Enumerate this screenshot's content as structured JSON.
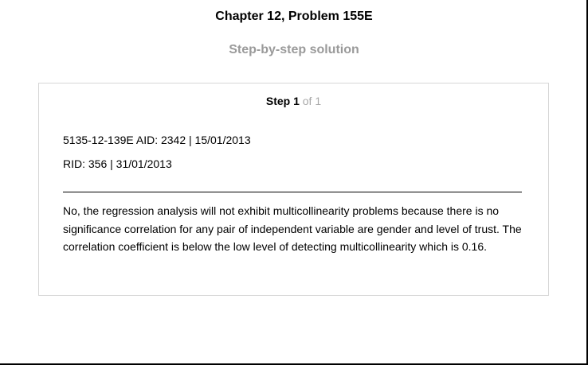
{
  "header": {
    "chapter_title": "Chapter 12, Problem 155E",
    "subtitle": "Step-by-step solution"
  },
  "step": {
    "label": "Step 1",
    "of_text": "of 1",
    "meta_line_1": "5135-12-139E AID: 2342 | 15/01/2013",
    "meta_line_2": "RID: 356 | 31/01/2013",
    "answer": "No, the regression analysis will not exhibit multicollinearity problems because there is no significance correlation for any pair of independent variable are gender and level of trust. The correlation coefficient is below the low level of detecting multicollinearity which is 0.16."
  },
  "colors": {
    "subtitle_gray": "#9a9a9a",
    "step_of_gray": "#a8a8a8",
    "card_border": "#d6d6d6"
  }
}
